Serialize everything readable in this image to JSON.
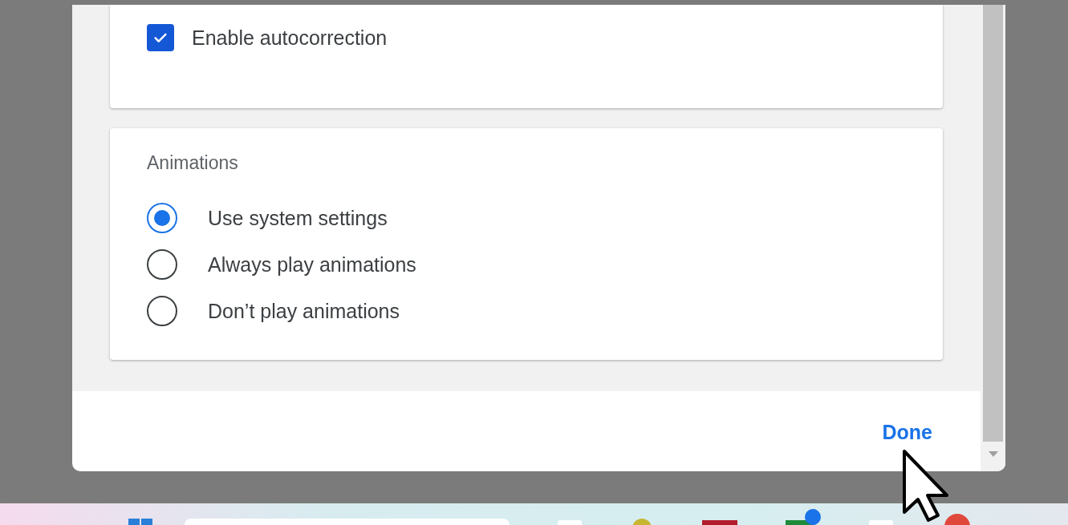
{
  "autocorrection": {
    "label": "Enable autocorrection",
    "checked": true
  },
  "animations": {
    "title": "Animations",
    "options": [
      {
        "label": "Use system settings",
        "selected": true
      },
      {
        "label": "Always play animations",
        "selected": false
      },
      {
        "label": "Don’t play animations",
        "selected": false
      }
    ]
  },
  "footer": {
    "done_button": "Done"
  }
}
